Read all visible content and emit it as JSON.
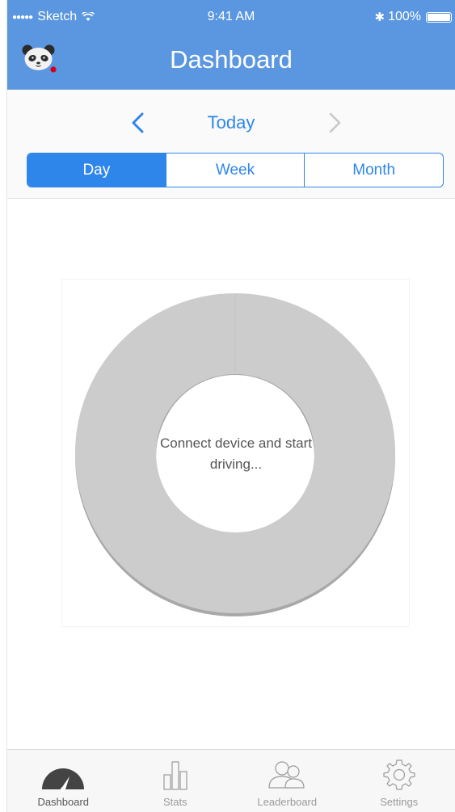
{
  "status_bar": {
    "dots": "●●●●●",
    "carrier": "Sketch",
    "wifi_icon": "wifi-icon",
    "time": "9:41 AM",
    "bluetooth": "✱",
    "battery_percent": "100%"
  },
  "header": {
    "title": "Dashboard",
    "avatar_icon": "panda-avatar-icon",
    "colors": {
      "background": "#5b97e0",
      "text": "#ffffff",
      "notification_dot": "#d0021b"
    }
  },
  "date_nav": {
    "label": "Today",
    "prev_icon": "chevron-left-icon",
    "next_icon": "chevron-right-icon",
    "segments": [
      {
        "label": "Day",
        "active": true
      },
      {
        "label": "Week",
        "active": false
      },
      {
        "label": "Month",
        "active": false
      }
    ],
    "colors": {
      "accent": "#2f86ea",
      "disabled": "#c7c7cc"
    }
  },
  "chart": {
    "empty_message": "Connect device and start driving...",
    "ring_color": "#cccccc",
    "ring_shadow_color": "#a8a8a8"
  },
  "tabbar": {
    "tabs": [
      {
        "label": "Dashboard",
        "icon": "speedometer-icon",
        "active": true
      },
      {
        "label": "Stats",
        "icon": "bar-chart-icon",
        "active": false
      },
      {
        "label": "Leaderboard",
        "icon": "people-icon",
        "active": false
      },
      {
        "label": "Settings",
        "icon": "gear-icon",
        "active": false
      }
    ]
  }
}
